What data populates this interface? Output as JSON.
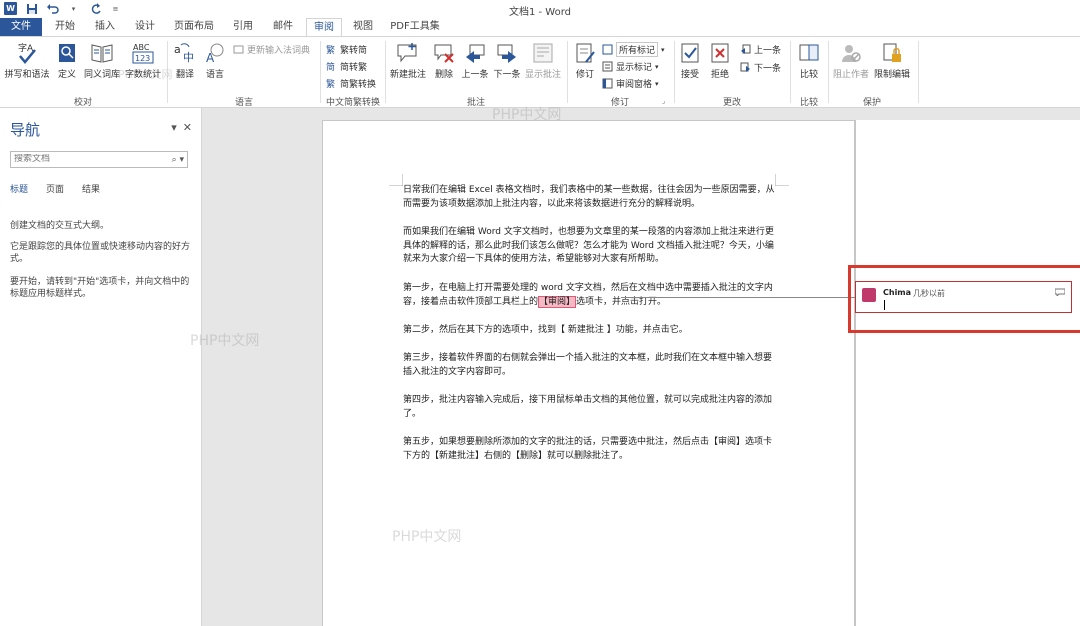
{
  "window": {
    "title": "文档1 - Word"
  },
  "tabs": [
    {
      "label": "文件"
    },
    {
      "label": "开始"
    },
    {
      "label": "插入"
    },
    {
      "label": "设计"
    },
    {
      "label": "页面布局"
    },
    {
      "label": "引用"
    },
    {
      "label": "邮件"
    },
    {
      "label": "审阅"
    },
    {
      "label": "视图"
    },
    {
      "label": "PDF工具集"
    }
  ],
  "ribbon": {
    "proofing": {
      "spelling": "拼写和语法",
      "define": "定义",
      "thesaurus": "同义词库",
      "wordcount": "字数统计",
      "group": "校对"
    },
    "language": {
      "translate": "翻译",
      "language": "语言",
      "update_ime": "更新输入法词典",
      "group": "语言"
    },
    "chinese": {
      "to_trad": "繁转简",
      "to_simp": "简转繁",
      "convert": "简繁转换",
      "group": "中文简繁转换"
    },
    "comments": {
      "new": "新建批注",
      "delete": "删除",
      "prev": "上一条",
      "next": "下一条",
      "show": "显示批注",
      "group": "批注"
    },
    "tracking": {
      "track": "修订",
      "markup_select": "所有标记",
      "show_markup": "显示标记",
      "review_pane": "审阅窗格",
      "group": "修订"
    },
    "changes": {
      "accept": "接受",
      "reject": "拒绝",
      "prev": "上一条",
      "next": "下一条",
      "group": "更改"
    },
    "compare": {
      "compare": "比较",
      "group": "比较"
    },
    "protect": {
      "block": "阻止作者",
      "restrict": "限制编辑",
      "group": "保护"
    }
  },
  "nav": {
    "title": "导航",
    "search_placeholder": "搜索文档",
    "tabs": [
      "标题",
      "页面",
      "结果"
    ],
    "help1": "创建文档的交互式大纲。",
    "help2": "它是跟踪您的具体位置或快速移动内容的好方式。",
    "help3": "要开始，请转到\"开始\"选项卡，并向文档中的标题应用标题样式。"
  },
  "document": {
    "p1": "日常我们在编辑 Excel 表格文档时，我们表格中的某一些数据，往往会因为一些原因需要，从而需要为该项数据添加上批注内容，以此来将该数据进行充分的解释说明。",
    "p2": "而如果我们在编辑 Word 文字文档时，也想要为文章里的某一段落的内容添加上批注来进行更具体的解释的话，那么此时我们该怎么做呢？怎么才能为 Word 文档插入批注呢？今天，小编就来为大家介绍一下具体的使用方法，希望能够对大家有所帮助。",
    "p3_before": "第一步，在电脑上打开需要处理的 word 文字文档，然后在文档中选中需要插入批注的文字内容，接着点击软件顶部工具栏上的",
    "p3_highlight": "【审阅】",
    "p3_after": "选项卡，并点击打开。",
    "p4": "第二步，然后在其下方的选项中，找到【 新建批注 】功能，并点击它。",
    "p5": "第三步，接着软件界面的右侧就会弹出一个插入批注的文本框，此时我们在文本框中输入想要插入批注的文字内容即可。",
    "p6": "第四步，批注内容输入完成后，接下用鼠标单击文档的其他位置，就可以完成批注内容的添加了。",
    "p7": "第五步，如果想要删除所添加的文字的批注的话，只需要选中批注，然后点击【审阅】选项卡下方的【新建批注】右侧的【删除】就可以删除批注了。"
  },
  "comment": {
    "author": "Chima",
    "time": "几秒以前"
  },
  "watermarks": [
    "PHP中文网",
    "PHP中文网",
    "PHP中文网",
    "PHP中文网"
  ],
  "colors": {
    "accent": "#2b579a",
    "highlight": "#f4b9c4",
    "red_box": "#d8392f"
  }
}
